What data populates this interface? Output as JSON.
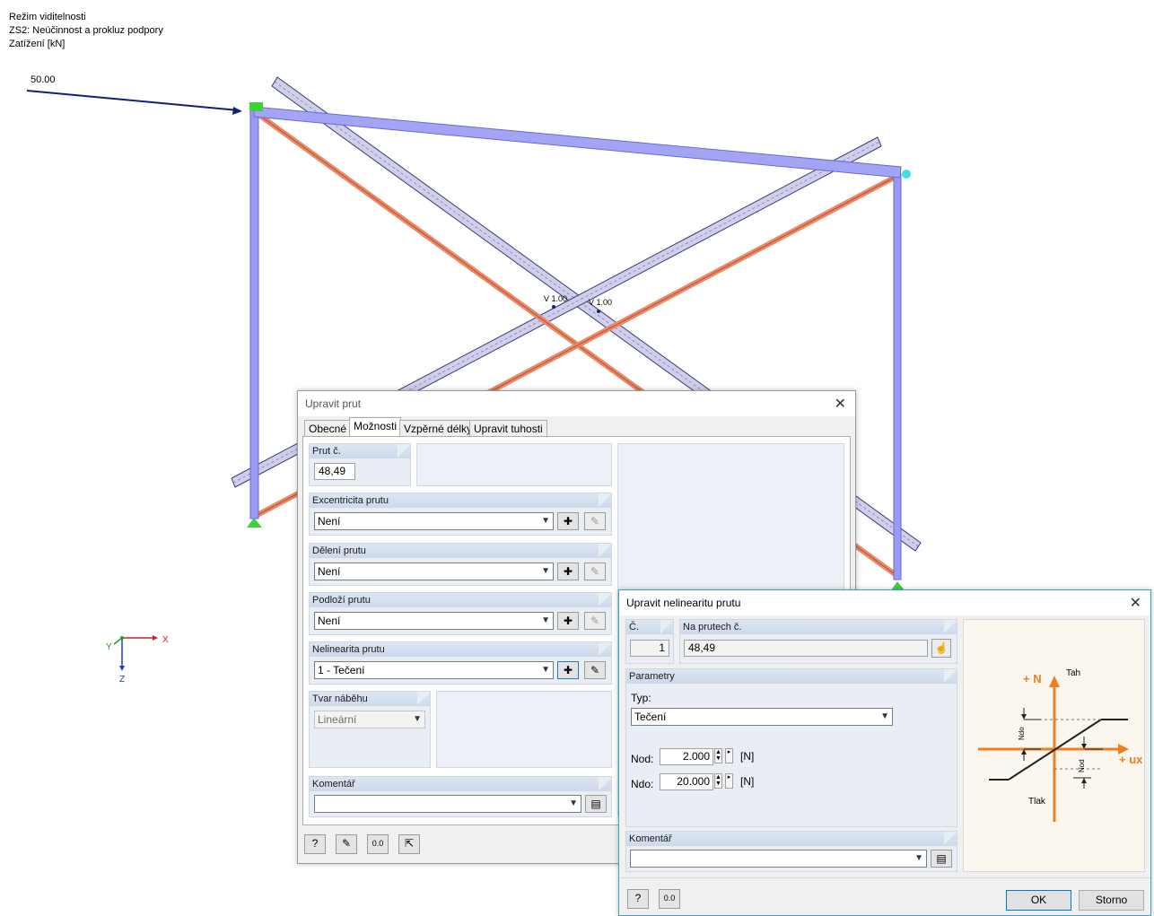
{
  "viewport": {
    "header_lines": [
      "Režim viditelnosti",
      "ZS2: Neúčinnost a prokluz podpory",
      "Zatížení [kN]"
    ],
    "load_value": "50.00",
    "hinge_label_1": "V 1.00",
    "hinge_label_2": "V 1.00",
    "axis_x": "X",
    "axis_y": "Y",
    "axis_z": "Z"
  },
  "dialog_member": {
    "title": "Upravit prut",
    "tabs": [
      "Obecné",
      "Možnosti",
      "Vzpěrné délky",
      "Upravit tuhosti"
    ],
    "active_tab": "Možnosti",
    "member_no_label": "Prut č.",
    "member_no_value": "48,49",
    "eccentricity_label": "Excentricita prutu",
    "eccentricity_value": "Není",
    "division_label": "Dělení prutu",
    "division_value": "Není",
    "foundation_label": "Podloží prutu",
    "foundation_value": "Není",
    "nonlinearity_label": "Nelinearita prutu",
    "nonlinearity_value": "1 - Tečení",
    "taper_label": "Tvar náběhu",
    "taper_value": "Lineární",
    "comment_label": "Komentář",
    "comment_value": ""
  },
  "dialog_nonlinearity": {
    "title": "Upravit nelinearitu prutu",
    "no_label": "Č.",
    "no_value": "1",
    "members_label": "Na prutech č.",
    "members_value": "48,49",
    "params_label": "Parametry",
    "type_label": "Typ:",
    "type_value": "Tečení",
    "nod_label": "Nod:",
    "nod_value": "2.000",
    "ndo_label": "Ndo:",
    "ndo_value": "20.000",
    "unit": "[N]",
    "comment_label": "Komentář",
    "comment_value": "",
    "ok": "OK",
    "cancel": "Storno",
    "diagram": {
      "n_axis": "+ N",
      "ux_axis": "+ ux",
      "tension": "Tah",
      "compression": "Tlak",
      "ndo": "Ndo",
      "nod": "Nod"
    }
  },
  "colors": {
    "member_blue": "#8a8af0",
    "member_orange": "#e0704a",
    "brace_grey": "#c8c8e8",
    "support_green": "#3cd23c",
    "accent_orange": "#f07d1e"
  }
}
